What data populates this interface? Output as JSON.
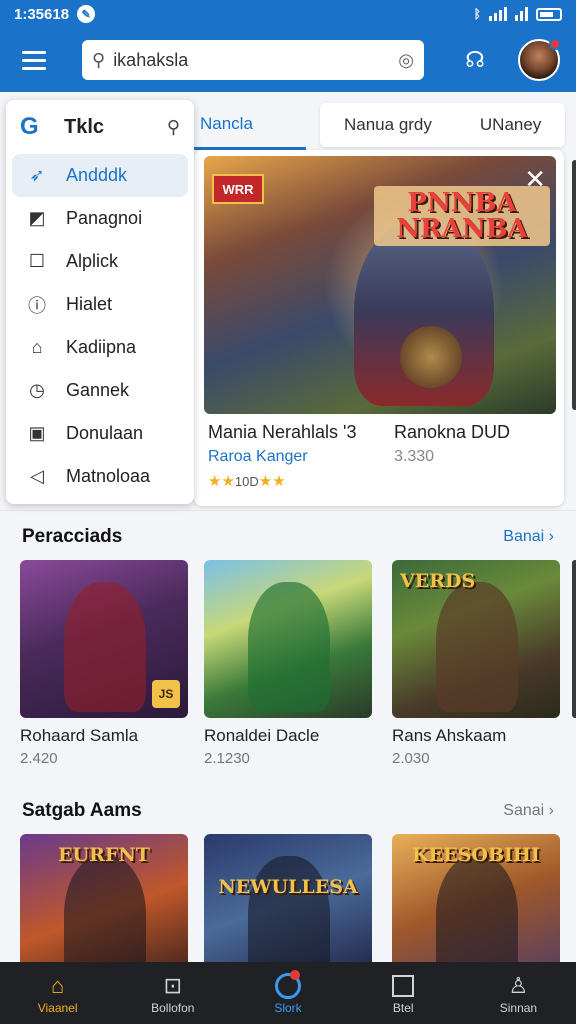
{
  "status": {
    "time": "1:35618"
  },
  "appbar": {
    "search_value": "ikahaksla"
  },
  "tabs": {
    "active": "Nancla",
    "group": [
      "Nanua grdy",
      "UNaney"
    ]
  },
  "drawer": {
    "title": "Tklc",
    "items": [
      {
        "label": "Andddk",
        "icon": "rocket-icon"
      },
      {
        "label": "Panagnoi",
        "icon": "edit-icon"
      },
      {
        "label": "Alplick",
        "icon": "square-icon"
      },
      {
        "label": "Hialet",
        "icon": "info-icon"
      },
      {
        "label": "Kadiipna",
        "icon": "home-icon"
      },
      {
        "label": "Gannek",
        "icon": "clock-icon"
      },
      {
        "label": "Donulaan",
        "icon": "download-icon"
      },
      {
        "label": "Matnoloaa",
        "icon": "send-icon"
      }
    ]
  },
  "featured": {
    "badge": "WRR",
    "logo": "PNNBA NRANBA",
    "title": "Mania Nerahlals '3",
    "subtitle": "Raroa Kanger",
    "stars": "★★",
    "rating": "10D",
    "stars_after": "★★",
    "title2": "Ranokna DUD",
    "price2": "3.330"
  },
  "section1": {
    "title": "Peracciads",
    "more": "Banai",
    "cards": [
      {
        "title": "Rohaard Samla",
        "count": "2.420",
        "label": "",
        "badge": "JS"
      },
      {
        "title": "Ronaldei Dacle",
        "count": "2.1230",
        "label": "",
        "badge": ""
      },
      {
        "title": "Rans Ahskaam",
        "count": "2.030",
        "label": "VERDS",
        "badge": ""
      }
    ]
  },
  "section2": {
    "title": "Satgab Aams",
    "more": "Sanai",
    "cards": [
      {
        "label": "EURFNT"
      },
      {
        "label": "NEWULLESA"
      },
      {
        "label": "KEESOBIHI"
      }
    ]
  },
  "bottomnav": [
    {
      "label": "Viaanel",
      "icon": "home-icon"
    },
    {
      "label": "Bollofon",
      "icon": "terminal-icon"
    },
    {
      "label": "Slork",
      "icon": "circle-icon"
    },
    {
      "label": "Btel",
      "icon": "square-icon"
    },
    {
      "label": "Sinnan",
      "icon": "user-icon"
    }
  ],
  "colors": {
    "primary": "#1a73c8",
    "nav_bg": "#1f2124",
    "star": "#f2b01e"
  }
}
